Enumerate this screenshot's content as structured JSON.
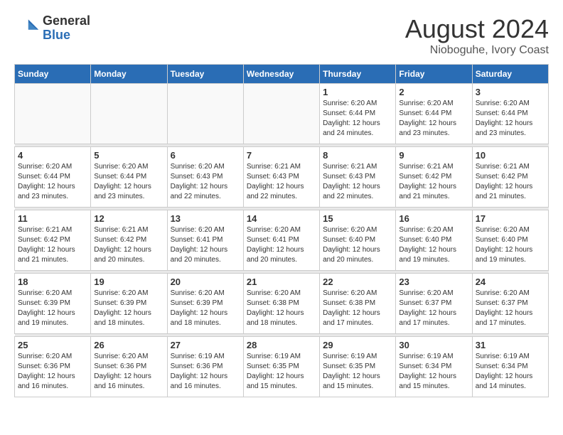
{
  "header": {
    "logo_line1": "General",
    "logo_line2": "Blue",
    "month_title": "August 2024",
    "subtitle": "Nioboguhe, Ivory Coast"
  },
  "calendar": {
    "days_of_week": [
      "Sunday",
      "Monday",
      "Tuesday",
      "Wednesday",
      "Thursday",
      "Friday",
      "Saturday"
    ],
    "weeks": [
      [
        {
          "day": "",
          "info": ""
        },
        {
          "day": "",
          "info": ""
        },
        {
          "day": "",
          "info": ""
        },
        {
          "day": "",
          "info": ""
        },
        {
          "day": "1",
          "info": "Sunrise: 6:20 AM\nSunset: 6:44 PM\nDaylight: 12 hours\nand 24 minutes."
        },
        {
          "day": "2",
          "info": "Sunrise: 6:20 AM\nSunset: 6:44 PM\nDaylight: 12 hours\nand 23 minutes."
        },
        {
          "day": "3",
          "info": "Sunrise: 6:20 AM\nSunset: 6:44 PM\nDaylight: 12 hours\nand 23 minutes."
        }
      ],
      [
        {
          "day": "4",
          "info": "Sunrise: 6:20 AM\nSunset: 6:44 PM\nDaylight: 12 hours\nand 23 minutes."
        },
        {
          "day": "5",
          "info": "Sunrise: 6:20 AM\nSunset: 6:44 PM\nDaylight: 12 hours\nand 23 minutes."
        },
        {
          "day": "6",
          "info": "Sunrise: 6:20 AM\nSunset: 6:43 PM\nDaylight: 12 hours\nand 22 minutes."
        },
        {
          "day": "7",
          "info": "Sunrise: 6:21 AM\nSunset: 6:43 PM\nDaylight: 12 hours\nand 22 minutes."
        },
        {
          "day": "8",
          "info": "Sunrise: 6:21 AM\nSunset: 6:43 PM\nDaylight: 12 hours\nand 22 minutes."
        },
        {
          "day": "9",
          "info": "Sunrise: 6:21 AM\nSunset: 6:42 PM\nDaylight: 12 hours\nand 21 minutes."
        },
        {
          "day": "10",
          "info": "Sunrise: 6:21 AM\nSunset: 6:42 PM\nDaylight: 12 hours\nand 21 minutes."
        }
      ],
      [
        {
          "day": "11",
          "info": "Sunrise: 6:21 AM\nSunset: 6:42 PM\nDaylight: 12 hours\nand 21 minutes."
        },
        {
          "day": "12",
          "info": "Sunrise: 6:21 AM\nSunset: 6:42 PM\nDaylight: 12 hours\nand 20 minutes."
        },
        {
          "day": "13",
          "info": "Sunrise: 6:20 AM\nSunset: 6:41 PM\nDaylight: 12 hours\nand 20 minutes."
        },
        {
          "day": "14",
          "info": "Sunrise: 6:20 AM\nSunset: 6:41 PM\nDaylight: 12 hours\nand 20 minutes."
        },
        {
          "day": "15",
          "info": "Sunrise: 6:20 AM\nSunset: 6:40 PM\nDaylight: 12 hours\nand 20 minutes."
        },
        {
          "day": "16",
          "info": "Sunrise: 6:20 AM\nSunset: 6:40 PM\nDaylight: 12 hours\nand 19 minutes."
        },
        {
          "day": "17",
          "info": "Sunrise: 6:20 AM\nSunset: 6:40 PM\nDaylight: 12 hours\nand 19 minutes."
        }
      ],
      [
        {
          "day": "18",
          "info": "Sunrise: 6:20 AM\nSunset: 6:39 PM\nDaylight: 12 hours\nand 19 minutes."
        },
        {
          "day": "19",
          "info": "Sunrise: 6:20 AM\nSunset: 6:39 PM\nDaylight: 12 hours\nand 18 minutes."
        },
        {
          "day": "20",
          "info": "Sunrise: 6:20 AM\nSunset: 6:39 PM\nDaylight: 12 hours\nand 18 minutes."
        },
        {
          "day": "21",
          "info": "Sunrise: 6:20 AM\nSunset: 6:38 PM\nDaylight: 12 hours\nand 18 minutes."
        },
        {
          "day": "22",
          "info": "Sunrise: 6:20 AM\nSunset: 6:38 PM\nDaylight: 12 hours\nand 17 minutes."
        },
        {
          "day": "23",
          "info": "Sunrise: 6:20 AM\nSunset: 6:37 PM\nDaylight: 12 hours\nand 17 minutes."
        },
        {
          "day": "24",
          "info": "Sunrise: 6:20 AM\nSunset: 6:37 PM\nDaylight: 12 hours\nand 17 minutes."
        }
      ],
      [
        {
          "day": "25",
          "info": "Sunrise: 6:20 AM\nSunset: 6:36 PM\nDaylight: 12 hours\nand 16 minutes."
        },
        {
          "day": "26",
          "info": "Sunrise: 6:20 AM\nSunset: 6:36 PM\nDaylight: 12 hours\nand 16 minutes."
        },
        {
          "day": "27",
          "info": "Sunrise: 6:19 AM\nSunset: 6:36 PM\nDaylight: 12 hours\nand 16 minutes."
        },
        {
          "day": "28",
          "info": "Sunrise: 6:19 AM\nSunset: 6:35 PM\nDaylight: 12 hours\nand 15 minutes."
        },
        {
          "day": "29",
          "info": "Sunrise: 6:19 AM\nSunset: 6:35 PM\nDaylight: 12 hours\nand 15 minutes."
        },
        {
          "day": "30",
          "info": "Sunrise: 6:19 AM\nSunset: 6:34 PM\nDaylight: 12 hours\nand 15 minutes."
        },
        {
          "day": "31",
          "info": "Sunrise: 6:19 AM\nSunset: 6:34 PM\nDaylight: 12 hours\nand 14 minutes."
        }
      ]
    ]
  }
}
